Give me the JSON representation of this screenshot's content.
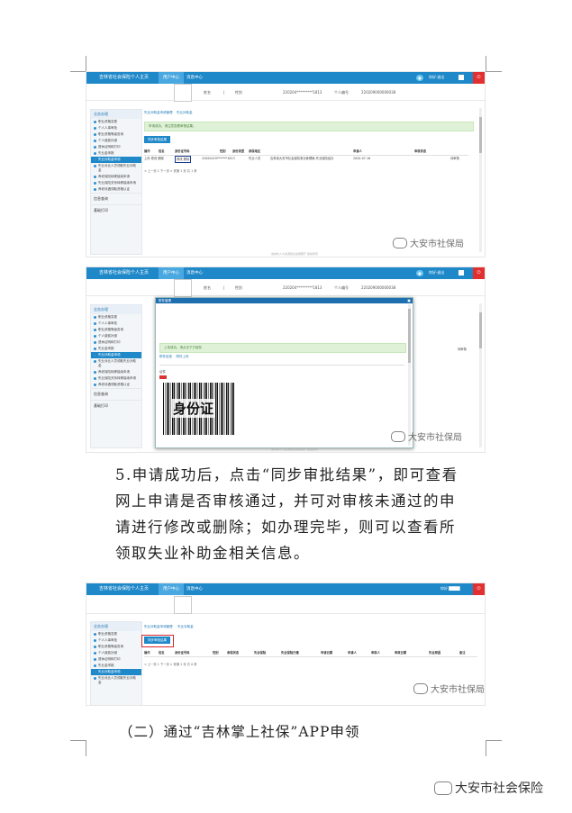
{
  "shot1": {
    "title": "吉林省社会保险个人主页",
    "tabs": [
      "用户中心",
      "消息中心"
    ],
    "info": {
      "l1": "姓名",
      "l2": "|",
      "l3": "性别",
      "id_label": "220204*********1813",
      "personal_label": "个人编号",
      "personal_no": "220209000000038"
    },
    "sidebar": {
      "header": "业务办理",
      "items": [
        "职业资格变更",
        "个人人事审批",
        "职业资格等级查询",
        "个人缴费补缴",
        "退休证明和打印",
        "失业金申报",
        "失业补助金申领",
        "失业对比人员领取失业补助金",
        "养老保险转移接续申请",
        "失业保险关系转移接续申请",
        "养老待遇领取资格认证"
      ],
      "selected_index": 6,
      "sections": [
        "信息查询",
        "基础打印"
      ]
    },
    "crumbs": [
      "失业补助金申请管理",
      "失业补助金",
      "新增"
    ],
    "alert": "申请成功，请注意查看审核结果。",
    "sync_button": "同步审批结果",
    "headers": [
      "操作",
      "姓名",
      "身份证号码",
      "性别",
      "身份类型",
      "所属机构",
      "参保地区",
      "申请人",
      "审核日期",
      "申请时间",
      "审核状态"
    ],
    "row": [
      "上传 修改 删除",
      "张某",
      "22020419*******1813",
      "男",
      "失业人员",
      "失业保险",
      "吉林省大安市社会保险事业管理局-失业保险经办",
      "2020-07-16",
      "待审核"
    ],
    "row_actions": "修改 删除",
    "pager": "< 上一页 1 下一页 > 到第 1 页 共 1 条",
    "footer": "吉林省人力资源和社会保障厅 版权所有"
  },
  "shot2": {
    "title": "吉林省社会保险个人主页",
    "tabs": [
      "用户中心",
      "消息中心"
    ],
    "modal_title": "附件管理",
    "modal_alert": "上传成功，请点击下方保存",
    "modal_tabs": [
      "附件信息",
      "附件上传"
    ],
    "id_label": "证件",
    "stamp": "身份证",
    "sidebar_items": [
      "职业资格变更",
      "个人人事审批",
      "职业资格等级查询",
      "个人缴费补缴",
      "退休证明和打印",
      "失业金申报",
      "失业补助金申领",
      "失业对比人员领取失业补助金",
      "养老保险转移接续申请",
      "失业保险关系转移接续申请",
      "养老待遇领取资格认证"
    ],
    "status_right": "待审核"
  },
  "paragraph": "5.申请成功后，点击“同步审批结果”，即可查看网上申请是否审核通过，并可对审核未通过的申请进行修改或删除；如办理完毕，则可以查看所领取失业补助金相关信息。",
  "shot3": {
    "title": "吉林省社会保险个人主页",
    "tabs": [
      "用户中心",
      "消息中心"
    ],
    "crumbs": [
      "失业补助金申领管理",
      "失业补助金"
    ],
    "sync_button": "同步审批结果",
    "headers": [
      "操作",
      "姓名",
      "身份证号码",
      "性别",
      "参保状态",
      "失业保险",
      "失业保险已缴",
      "申请日期",
      "申请人",
      "审核人",
      "审核日期",
      "失业原因",
      "备注"
    ],
    "pager": "< 上一页 1 下一页 > 到第 1 页 共 0 条",
    "sidebar_items": [
      "职业资格变更",
      "个人人事审批",
      "职业资格等级查询",
      "个人缴费补缴",
      "退休证明和打印",
      "失业金申报",
      "失业补助金申领",
      "失业对比人员领取失业补助金"
    ]
  },
  "heading2": "（二）通过“吉林掌上社保”APP申领",
  "watermark": "大安市社保局",
  "footer_watermark": "大安市社会保险"
}
